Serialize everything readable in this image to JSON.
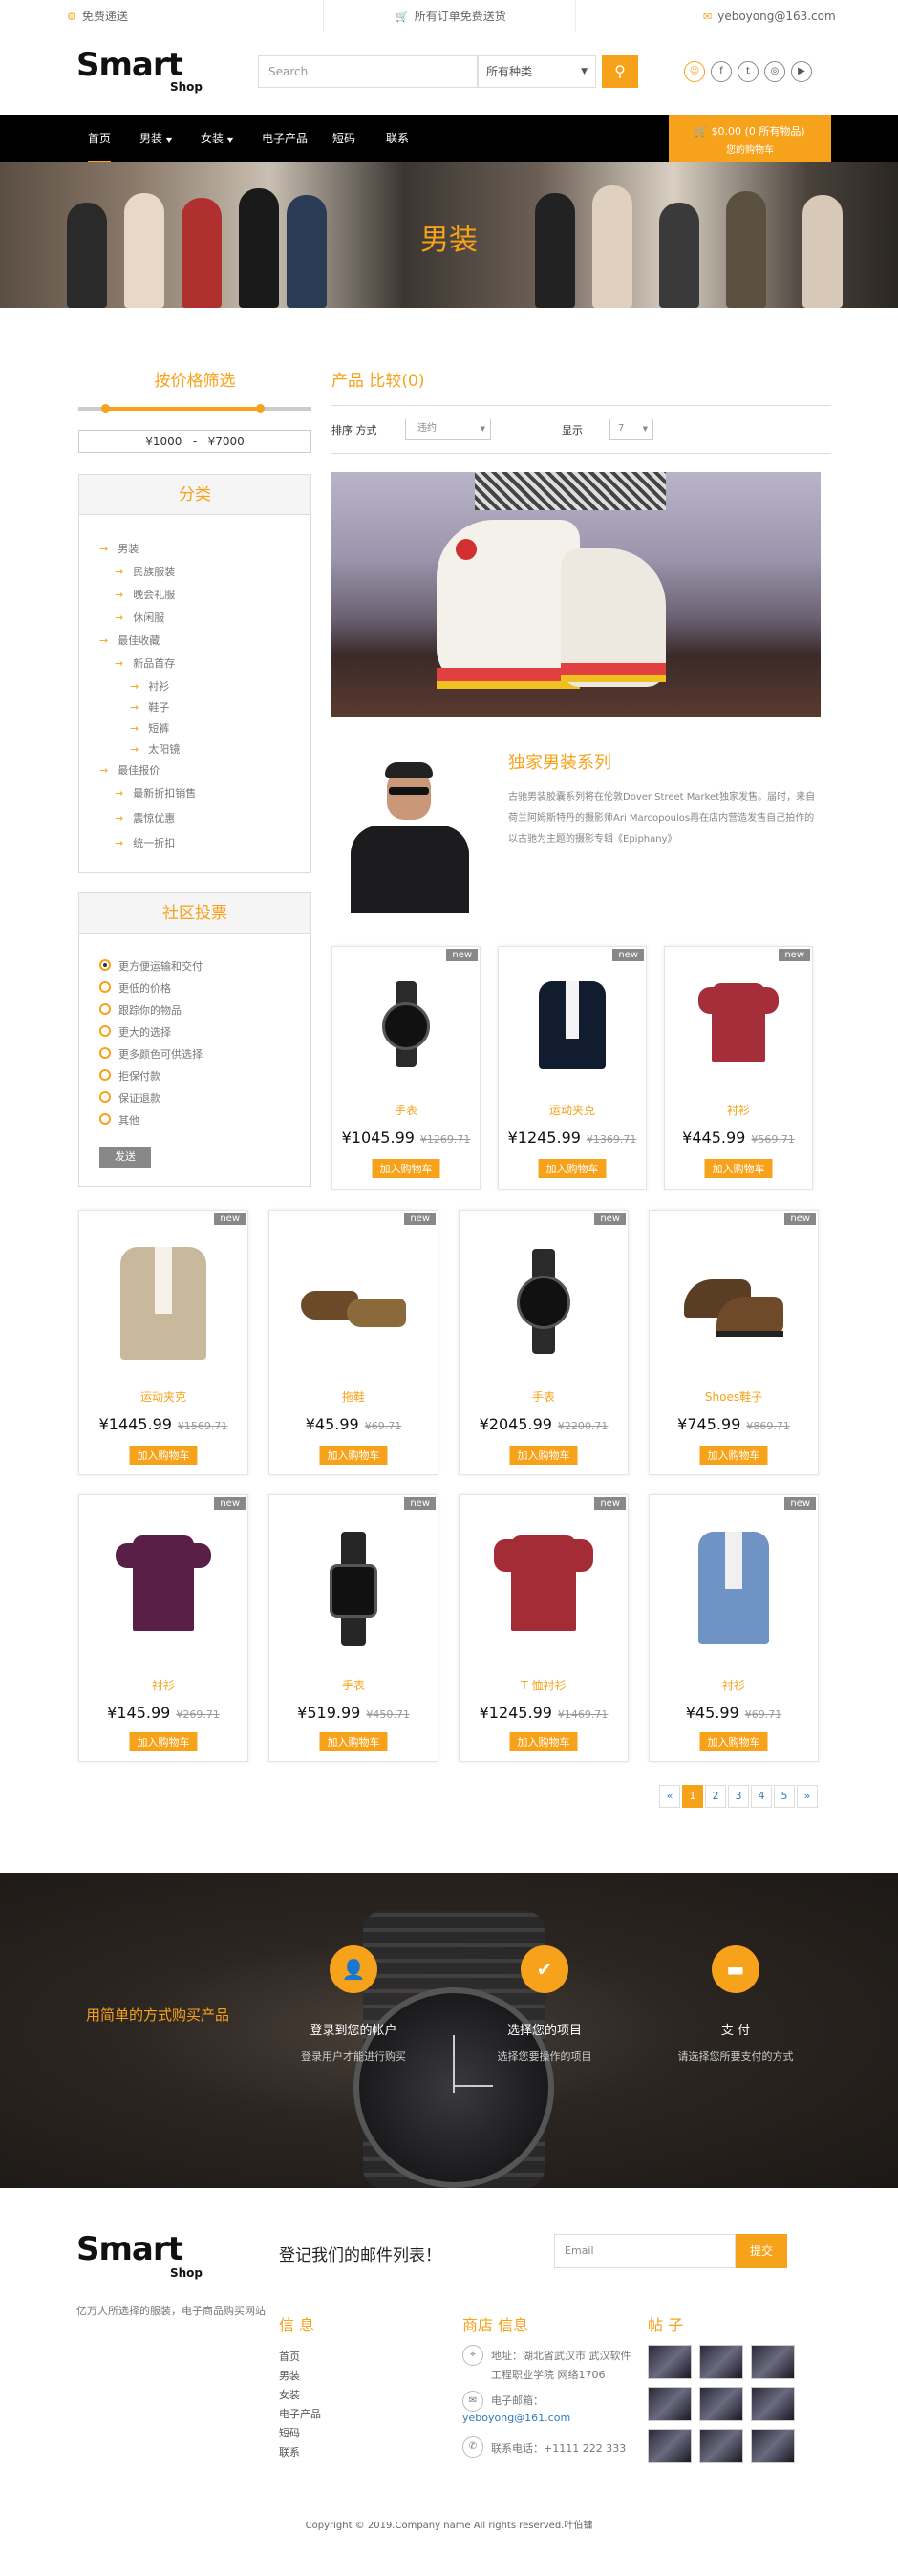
{
  "topbar": {
    "shipping": "免费递送",
    "free_shipping": "所有订单免费送货",
    "email": "yeboyong@163.com"
  },
  "header": {
    "logo_main": "Smart",
    "logo_sub": "Shop",
    "search_placeholder": "Search",
    "search_select": "所有种类",
    "search_icon": "search-icon"
  },
  "nav": {
    "items": [
      "首页",
      "男装",
      "女装",
      "电子产品",
      "短码",
      "联系"
    ],
    "cart_line1": "$0.00 (0 所有物品)",
    "cart_line2": "您的购物车"
  },
  "banner": {
    "title": "男装"
  },
  "sidebar": {
    "price_title": "按价格筛选",
    "price_min": "¥1000",
    "price_sep": "-",
    "price_max": "¥7000",
    "category_title": "分类",
    "categories": [
      "男装",
      "民族服装",
      "晚会礼服",
      "休闲服",
      "最佳收藏",
      "新品首存",
      "衬衫",
      "鞋子",
      "短裤",
      "太阳镜",
      "最佳报价",
      "最新折扣销售",
      "震惊优惠",
      "统一折扣"
    ],
    "poll_title": "社区投票",
    "poll_options": [
      "更方便运输和交付",
      "更低的价格",
      "跟踪你的物品",
      "更大的选择",
      "更多颜色可供选择",
      "拒保付款",
      "保证退款",
      "其他"
    ],
    "poll_button": "发送"
  },
  "main": {
    "title": "产品 比较(0)",
    "sort_label": "排序 方式",
    "sort_value": "违约",
    "show_label": "显示",
    "show_value": "7",
    "feature_title": "独家男装系列",
    "feature_desc": "古驰男装胶囊系列将在伦敦Dover Street Market独家发售。届时，来自荷兰阿姆斯特丹的摄影师Ari Marcopoulos再在店内营造发售自己拍作的以古驰为主题的摄影专辑《Epiphany》"
  },
  "products": [
    {
      "name": "手表",
      "price": "¥1045.99",
      "old": "¥1269.71",
      "badge": "new",
      "btn": "加入购物车"
    },
    {
      "name": "运动夹克",
      "price": "¥1245.99",
      "old": "¥1369.71",
      "badge": "new",
      "btn": "加入购物车"
    },
    {
      "name": "衬衫",
      "price": "¥445.99",
      "old": "¥569.71",
      "badge": "new",
      "btn": "加入购物车"
    },
    {
      "name": "运动夹克",
      "price": "¥1445.99",
      "old": "¥1569.71",
      "badge": "new",
      "btn": "加入购物车"
    },
    {
      "name": "拖鞋",
      "price": "¥45.99",
      "old": "¥69.71",
      "badge": "new",
      "btn": "加入购物车"
    },
    {
      "name": "手表",
      "price": "¥2045.99",
      "old": "¥2200.71",
      "badge": "new",
      "btn": "加入购物车"
    },
    {
      "name": "Shoes鞋子",
      "price": "¥745.99",
      "old": "¥869.71",
      "badge": "new",
      "btn": "加入购物车"
    },
    {
      "name": "衬衫",
      "price": "¥145.99",
      "old": "¥269.71",
      "badge": "new",
      "btn": "加入购物车"
    },
    {
      "name": "手表",
      "price": "¥519.99",
      "old": "¥450.71",
      "badge": "new",
      "btn": "加入购物车"
    },
    {
      "name": "T 恤衬衫",
      "price": "¥1245.99",
      "old": "¥1469.71",
      "badge": "new",
      "btn": "加入购物车"
    },
    {
      "name": "衬衫",
      "price": "¥45.99",
      "old": "¥69.71",
      "badge": "new",
      "btn": "加入购物车"
    }
  ],
  "pagination": {
    "prev": "«",
    "pages": [
      "1",
      "2",
      "3",
      "4",
      "5"
    ],
    "next": "»"
  },
  "howto": {
    "headline": "用简单的方式购买产品",
    "steps": [
      {
        "title": "登录到您的帐户",
        "desc": "登录用户才能进行购买"
      },
      {
        "title": "选择您的项目",
        "desc": "选择您要操作的项目"
      },
      {
        "title": "支 付",
        "desc": "请选择您所要支付的方式"
      }
    ]
  },
  "footer": {
    "logo_main": "Smart",
    "logo_sub": "Shop",
    "tagline": "亿万人所选择的服装，电子商品购买网站",
    "newsletter": "登记我们的邮件列表！",
    "email_placeholder": "Email",
    "submit": "提交",
    "info_title": "信 息",
    "info_links": [
      "首页",
      "男装",
      "女装",
      "电子产品",
      "短码",
      "联系"
    ],
    "store_title": "商店 信息",
    "address": "地址：湖北省武汉市 武汉软件工程职业学院 网络1706",
    "email_label": "电子邮箱：",
    "email": "yeboyong@161.com",
    "phone": "联系电话：+1111 222 333",
    "posts_title": "帖 子",
    "copyright": "Copyright © 2019.Company name All rights reserved.叶伯镛"
  }
}
